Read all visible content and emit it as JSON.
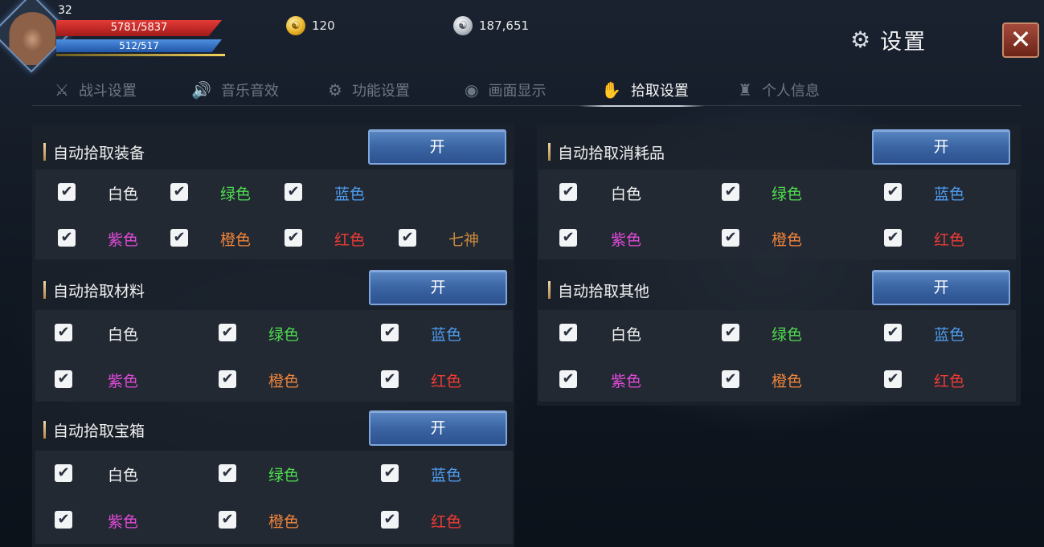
{
  "player": {
    "level": "32",
    "hp": "5781/5837",
    "mp": "512/517"
  },
  "currency": {
    "gold": "120",
    "silver": "187,651"
  },
  "header": {
    "title": "设置",
    "close_label": "✕"
  },
  "tabs": [
    {
      "label": "战斗设置",
      "icon": "crossed-swords-icon",
      "active": false
    },
    {
      "label": "音乐音效",
      "icon": "speaker-icon",
      "active": false
    },
    {
      "label": "功能设置",
      "icon": "gear-icon",
      "active": false
    },
    {
      "label": "画面显示",
      "icon": "eye-icon",
      "active": false
    },
    {
      "label": "拾取设置",
      "icon": "hand-pickup-icon",
      "active": true
    },
    {
      "label": "个人信息",
      "icon": "helmet-icon",
      "active": false
    }
  ],
  "check_mark": "✔",
  "sections": {
    "equipment": {
      "title": "自动拾取装备",
      "toggle": "开",
      "options": [
        "白色",
        "绿色",
        "蓝色",
        "紫色",
        "橙色",
        "红色",
        "七神"
      ]
    },
    "materials": {
      "title": "自动拾取材料",
      "toggle": "开",
      "options": [
        "白色",
        "绿色",
        "蓝色",
        "紫色",
        "橙色",
        "红色"
      ]
    },
    "chests": {
      "title": "自动拾取宝箱",
      "toggle": "开",
      "options": [
        "白色",
        "绿色",
        "蓝色",
        "紫色",
        "橙色",
        "红色"
      ]
    },
    "consumables": {
      "title": "自动拾取消耗品",
      "toggle": "开",
      "options": [
        "白色",
        "绿色",
        "蓝色",
        "紫色",
        "橙色",
        "红色"
      ]
    },
    "others": {
      "title": "自动拾取其他",
      "toggle": "开",
      "options": [
        "白色",
        "绿色",
        "蓝色",
        "紫色",
        "橙色",
        "红色"
      ]
    }
  },
  "colors": {
    "white": "#f2f2f2",
    "green": "#4fdb4f",
    "blue": "#4e9df0",
    "purple": "#e04ad8",
    "orange": "#f0843a",
    "red": "#ef3b34",
    "gold": "#c98a3c",
    "toggle_blue": "#3a64a2"
  }
}
